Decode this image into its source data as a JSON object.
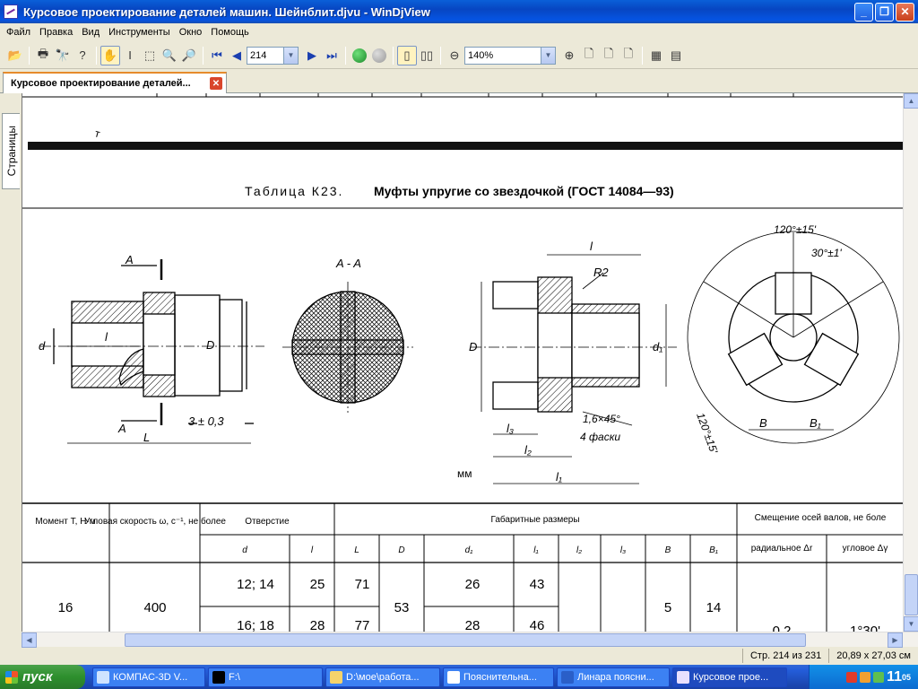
{
  "window": {
    "title": "Курсовое проектирование деталей машин. Шейнблит.djvu - WinDjView"
  },
  "menu": [
    "Файл",
    "Правка",
    "Вид",
    "Инструменты",
    "Окно",
    "Помощь"
  ],
  "toolbar": {
    "page_value": "214",
    "zoom_value": "140%"
  },
  "tab": {
    "label": "Курсовое проектирование деталей..."
  },
  "side": {
    "pages_label": "Страницы"
  },
  "document": {
    "table_caption_prefix": "Таблица К23.",
    "table_caption_title": "Муфты упругие со звездочкой (ГОСТ 14084—93)",
    "drawing_labels": {
      "section_a_left": "A",
      "section_a_bottom": "A",
      "section_view": "A - A",
      "d": "d",
      "l": "l",
      "L": "L",
      "D": "D",
      "tol": "3 ± 0,3",
      "l_top": "l",
      "R2": "R2",
      "D_right": "D",
      "d1": "d₁",
      "l3": "l₃",
      "l2": "l₂",
      "l1": "l₁",
      "chamfer": "1,6×45°",
      "chamfer2": "4 фаски",
      "mm": "мм",
      "angle1": "120°±15'",
      "angle2": "30°±1'",
      "angle3": "120°±15'",
      "B": "B",
      "B1": "B₁"
    },
    "table": {
      "headers": {
        "moment": "Момент T, Н·м",
        "speed": "Угловая скорость ω, с⁻¹, не более",
        "bore": "Отверстие",
        "dims": "Габаритные размеры",
        "offset": "Смещение осей валов, не боле",
        "d": "d",
        "l": "l",
        "L": "L",
        "D": "D",
        "d1": "d₁",
        "l1": "l₁",
        "l2": "l₂",
        "l3": "l₃",
        "B": "B",
        "B1": "B₁",
        "radial": "радиальное Δr",
        "angular": "угловое Δγ"
      },
      "rows": [
        {
          "moment": "16",
          "speed": "400",
          "d": "12; 14",
          "l": "25",
          "L": "71",
          "D": "53",
          "d1": "26",
          "l1": "43",
          "B": "5",
          "B1": "14"
        },
        {
          "d": "16; 18",
          "l": "28",
          "L": "77",
          "d1": "28",
          "l1": "46",
          "radial": "0,2",
          "angular": "1°30'"
        }
      ]
    }
  },
  "status": {
    "page": "Стр. 214 из 231",
    "size": "20,89 x 27,03 см"
  },
  "taskbar": {
    "start": "пуск",
    "items": [
      "КОМПАС-3D V...",
      "F:\\",
      "D:\\мое\\работа...",
      "Пояснительна...",
      "Линара поясни...",
      "Курсовое прое..."
    ],
    "clock_hours": "11",
    "clock_minutes": "05"
  }
}
